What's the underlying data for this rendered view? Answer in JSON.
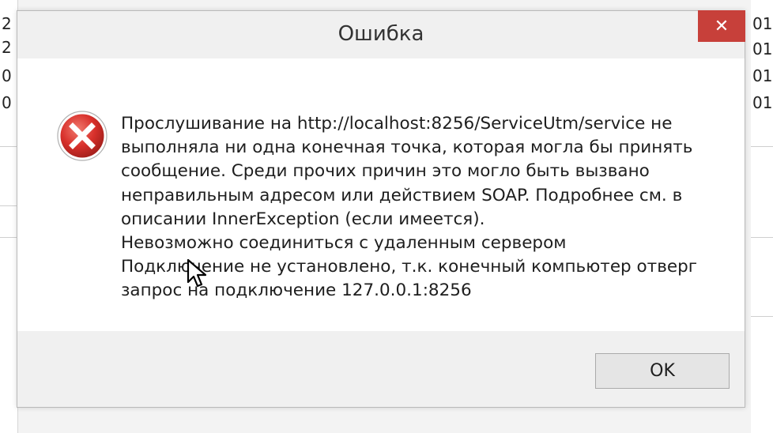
{
  "dialog": {
    "title": "Ошибка",
    "close_label": "✕",
    "icon": "error-icon",
    "message_lines": [
      "Прослушивание на http://localhost:8256/ServiceUtm/service не",
      "выполняла ни одна конечная точка, которая могла бы принять",
      "сообщение. Среди прочих причин это могло быть вызвано",
      "неправильным адресом или действием SOAP. Подробнее см. в",
      "описании InnerException (если имеется).",
      "Невозможно соединиться с удаленным сервером",
      "Подключение не установлено, т.к. конечный компьютер отверг",
      "запрос на подключение 127.0.0.1:8256"
    ],
    "ok_label": "OK"
  },
  "background": {
    "right_column": [
      "01",
      "01",
      "01",
      "01"
    ],
    "left_column": [
      "2",
      "2",
      "0",
      "0"
    ]
  },
  "colors": {
    "close_button": "#c7403a",
    "error_icon": "#d8302b",
    "dialog_bg": "#f0f0f0",
    "content_bg": "#ffffff"
  }
}
